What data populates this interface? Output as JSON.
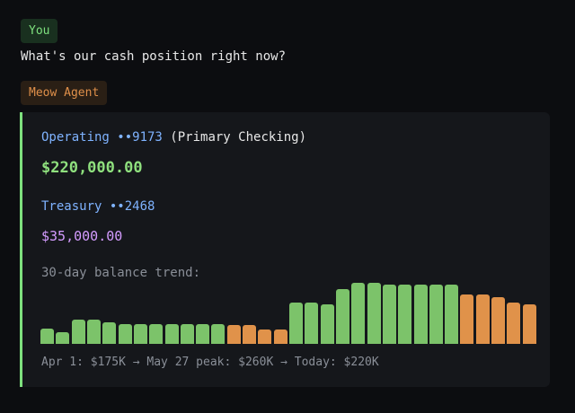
{
  "conversation": {
    "user_tag": "You",
    "user_message": "What's our cash position right now?",
    "agent_tag": "Meow Agent"
  },
  "accounts": [
    {
      "name": "Operating ••9173",
      "description": "(Primary Checking)",
      "balance": "$220,000.00"
    },
    {
      "name": "Treasury ••2468",
      "balance": "$35,000.00"
    }
  ],
  "trend": {
    "label": "30-day balance trend:",
    "summary": "Apr 1: $175K → May 27 peak: $260K → Today: $220K"
  },
  "colors": {
    "up": "#7cc36a",
    "down": "#e0924a",
    "accent_border": "#7ee07e"
  },
  "chart_data": {
    "type": "bar",
    "unit": "USD thousands",
    "ylim": [
      0,
      260
    ],
    "grid": false,
    "values": [
      {
        "value": 175,
        "color": "up"
      },
      {
        "value": 168,
        "color": "up"
      },
      {
        "value": 192,
        "color": "up"
      },
      {
        "value": 192,
        "color": "up"
      },
      {
        "value": 187,
        "color": "up"
      },
      {
        "value": 184,
        "color": "up"
      },
      {
        "value": 184,
        "color": "up"
      },
      {
        "value": 184,
        "color": "up"
      },
      {
        "value": 184,
        "color": "up"
      },
      {
        "value": 183,
        "color": "up"
      },
      {
        "value": 183,
        "color": "up"
      },
      {
        "value": 183,
        "color": "up"
      },
      {
        "value": 181,
        "color": "down"
      },
      {
        "value": 181,
        "color": "down"
      },
      {
        "value": 173,
        "color": "down"
      },
      {
        "value": 173,
        "color": "down"
      },
      {
        "value": 223,
        "color": "up"
      },
      {
        "value": 223,
        "color": "up"
      },
      {
        "value": 220,
        "color": "up"
      },
      {
        "value": 248,
        "color": "up"
      },
      {
        "value": 260,
        "color": "up"
      },
      {
        "value": 260,
        "color": "up"
      },
      {
        "value": 257,
        "color": "up"
      },
      {
        "value": 257,
        "color": "up"
      },
      {
        "value": 257,
        "color": "up"
      },
      {
        "value": 257,
        "color": "up"
      },
      {
        "value": 257,
        "color": "up"
      },
      {
        "value": 238,
        "color": "down"
      },
      {
        "value": 238,
        "color": "down"
      },
      {
        "value": 234,
        "color": "down"
      },
      {
        "value": 223,
        "color": "down"
      },
      {
        "value": 220,
        "color": "down"
      }
    ]
  }
}
